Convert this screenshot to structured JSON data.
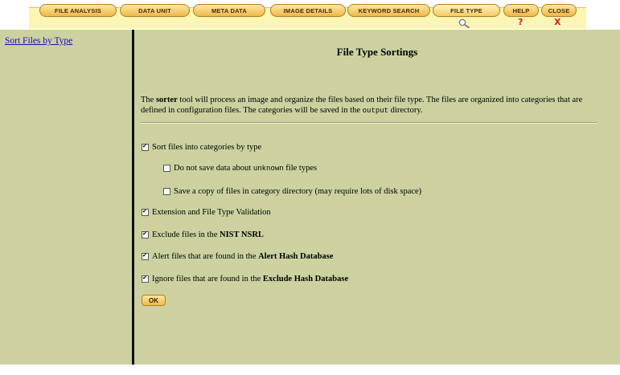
{
  "tabs": [
    {
      "label": "File Analysis"
    },
    {
      "label": "Data Unit"
    },
    {
      "label": "Meta Data"
    },
    {
      "label": "Image Details"
    },
    {
      "label": "Keyword Search"
    },
    {
      "label": "File Type"
    },
    {
      "label": "Help"
    },
    {
      "label": "Close"
    }
  ],
  "icons": {
    "search": "magnifier-icon",
    "help": "question-icon",
    "close": "close-x-icon"
  },
  "help_glyph": "?",
  "close_glyph": "X",
  "sidebar": {
    "link": "Sort Files by Type"
  },
  "main": {
    "title": "File Type Sortings",
    "intro": {
      "p1": "The ",
      "bold": "sorter",
      "p2": " tool will process an image and organize the files based on their file type. The files are organized into categories that are defined in configuration files. The categories will be saved in the ",
      "code": "output",
      "p3": " directory."
    },
    "options": [
      {
        "checked": true,
        "text": "Sort files into categories by type"
      },
      {
        "checked": false,
        "pre": "Do not save data about ",
        "code": "unknown",
        "post": " file types"
      },
      {
        "checked": false,
        "text": "Save a copy of files in category directory (may require lots of disk space)"
      },
      {
        "checked": true,
        "text": "Extension and File Type Validation"
      },
      {
        "checked": true,
        "pre": "Exclude files in the ",
        "bold": "NIST NSRL"
      },
      {
        "checked": true,
        "pre": "Alert files that are found in the ",
        "bold": "Alert Hash Database"
      },
      {
        "checked": true,
        "pre": "Ignore files that are found in the ",
        "bold": "Exclude Hash Database"
      }
    ],
    "ok_label": "OK"
  },
  "colors": {
    "panel_bg": "#cdd1a0",
    "tab_fill": "#f0b94a",
    "tab_border": "#b07e1b",
    "strip": "#fcf6b4",
    "link": "#1a0dab",
    "glyph_red": "#cc2a1a"
  }
}
